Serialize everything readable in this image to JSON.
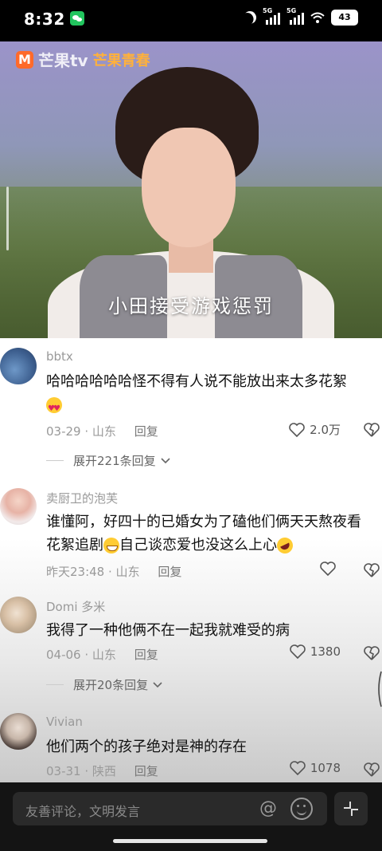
{
  "status_bar": {
    "time": "8:32",
    "network_1": "5G",
    "network_2": "5G",
    "battery": "43"
  },
  "video": {
    "logo_text": "芒果tv",
    "logo_sub": "芒果青春",
    "caption": "小田接受游戏惩罚"
  },
  "comments": [
    {
      "username": "bbtx",
      "text": "哈哈哈哈哈哈怪不得有人说不能放出来太多花絮",
      "emoji": "star-struck-emoji",
      "date": "03-29 · 山东",
      "reply_label": "回复",
      "likes": "2.0万",
      "replies_label": "展开221条回复"
    },
    {
      "username": "卖厨卫的泡芙",
      "text_a": "谁懂阿，好四十的已婚女为了磕他们俩天天熬夜看花絮追剧",
      "text_b": "自己谈恋爱也没这么上心",
      "date": "昨天23:48 · 山东",
      "reply_label": "回复",
      "likes": ""
    },
    {
      "username": "Domi 多米",
      "text": "我得了一种他俩不在一起我就难受的病",
      "date": "04-06 · 山东",
      "reply_label": "回复",
      "likes": "1380",
      "replies_label": "展开20条回复"
    },
    {
      "username": "Vivian",
      "text": "他们两个的孩子绝对是神的存在",
      "date": "03-31 · 陕西",
      "reply_label": "回复",
      "likes": "1078"
    }
  ],
  "input_bar": {
    "placeholder": "友善评论，文明发言",
    "at_symbol": "@"
  }
}
